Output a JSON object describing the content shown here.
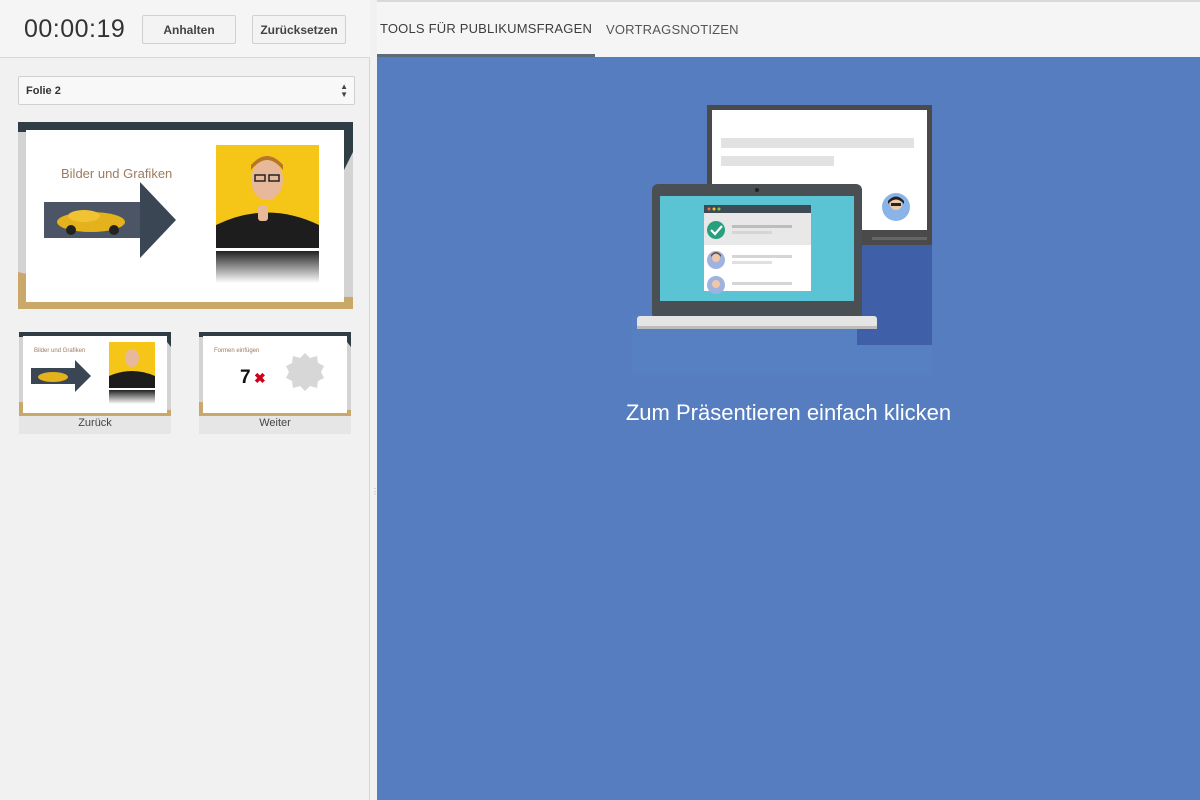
{
  "timer": {
    "value": "00:00:19"
  },
  "controls": {
    "pause_label": "Anhalten",
    "reset_label": "Zurücksetzen"
  },
  "slide_select": {
    "value": "Folie 2"
  },
  "current_slide": {
    "title": "Bilder und Grafiken"
  },
  "thumbnails": [
    {
      "slide_title": "Bilder und Grafiken",
      "caption": "Zurück"
    },
    {
      "slide_title": "Formen einfügen",
      "counter": "7",
      "caption": "Weiter"
    }
  ],
  "tabs": [
    {
      "label": "TOOLS FÜR PUBLIKUMSFRAGEN",
      "active": true
    },
    {
      "label": "VORTRAGSNOTIZEN",
      "active": false
    }
  ],
  "audience": {
    "prompt": "Zum Präsentieren einfach klicken"
  },
  "colors": {
    "stage_blue": "#567dbf",
    "tab_underline": "#5b6b78",
    "slide_gold": "#c9a86a",
    "slide_dark": "#2f3d44"
  }
}
